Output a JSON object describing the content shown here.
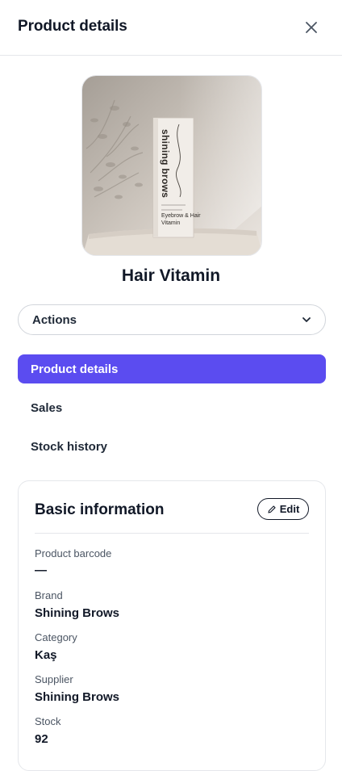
{
  "header": {
    "title": "Product details",
    "close_icon": "close-icon"
  },
  "product": {
    "name": "Hair Vitamin",
    "image_text": {
      "brand_vertical": "shining brows",
      "line1": "Eyebrow & Hair",
      "line2": "Vitamin"
    }
  },
  "actions": {
    "label": "Actions",
    "icon": "chevron-down-icon"
  },
  "nav": {
    "items": [
      {
        "label": "Product details",
        "active": true
      },
      {
        "label": "Sales",
        "active": false
      },
      {
        "label": "Stock history",
        "active": false
      }
    ]
  },
  "basic_info": {
    "title": "Basic information",
    "edit_label": "Edit",
    "edit_icon": "pencil-icon",
    "fields": [
      {
        "label": "Product barcode",
        "value": "—"
      },
      {
        "label": "Brand",
        "value": "Shining Brows"
      },
      {
        "label": "Category",
        "value": "Kaş"
      },
      {
        "label": "Supplier",
        "value": "Shining Brows"
      },
      {
        "label": "Stock",
        "value": "92"
      }
    ]
  },
  "colors": {
    "accent": "#5b4cf0",
    "text": "#111827",
    "border": "#e5e7eb"
  }
}
